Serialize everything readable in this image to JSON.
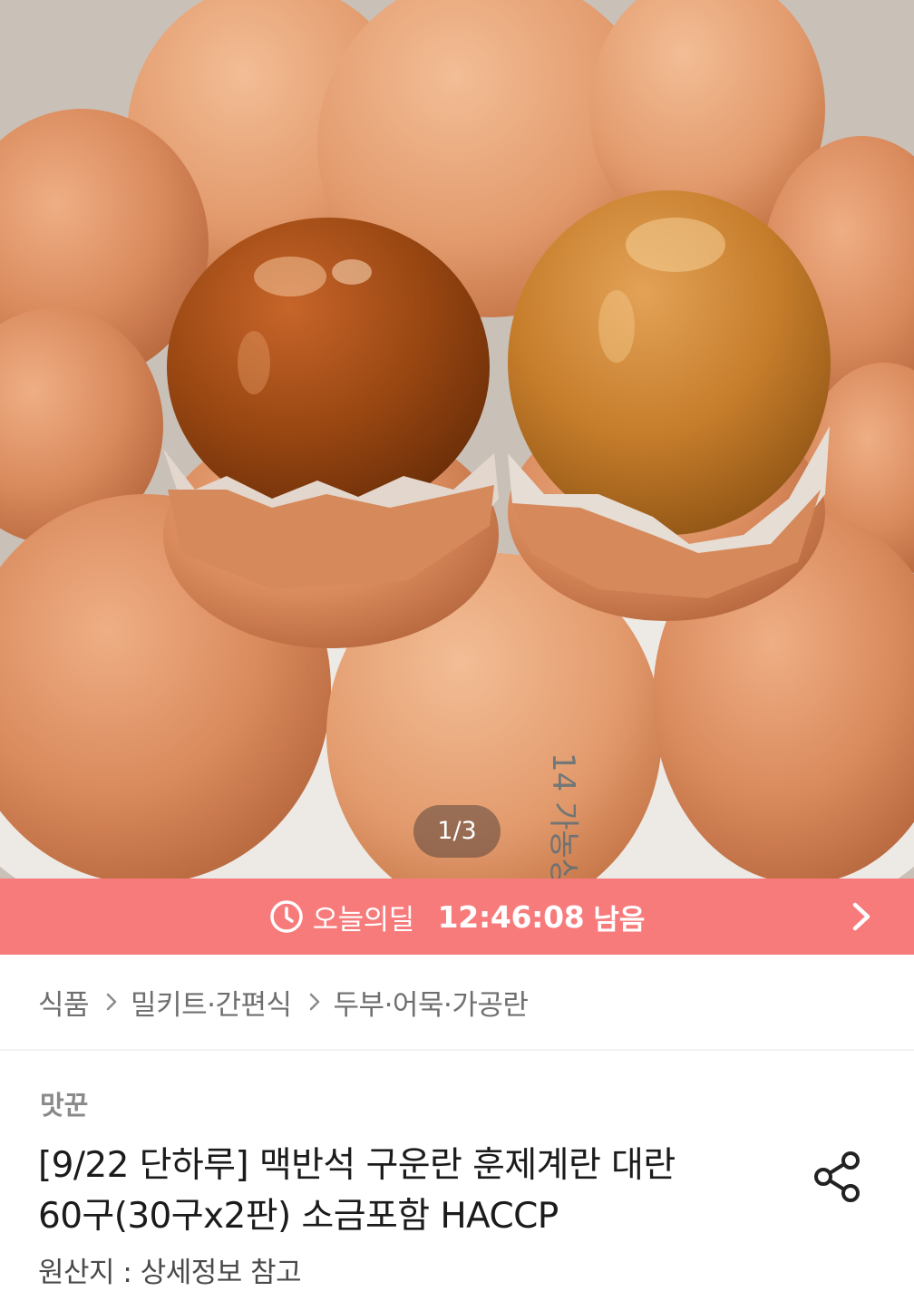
{
  "gallery": {
    "counter": "1/3",
    "egg_stamp": "14 가농상"
  },
  "deal_banner": {
    "icon": "clock-icon",
    "label": "오늘의딜",
    "timer": "12:46:08",
    "remaining": "남음",
    "arrow_icon": "chevron-right-icon",
    "color": "#f87b7c"
  },
  "breadcrumb": {
    "items": [
      "식품",
      "밀키트·간편식",
      "두부·어묵·가공란"
    ],
    "separator_icon": "chevron-right-icon"
  },
  "product": {
    "brand": "맛꾼",
    "title_line1": "[9/22 단하루] 맥반석 구운란 훈제계란 대란",
    "title_line2": "60구(30구x2판) 소금포함 HACCP",
    "origin": "원산지 : 상세정보 참고",
    "share_icon": "share-icon"
  }
}
